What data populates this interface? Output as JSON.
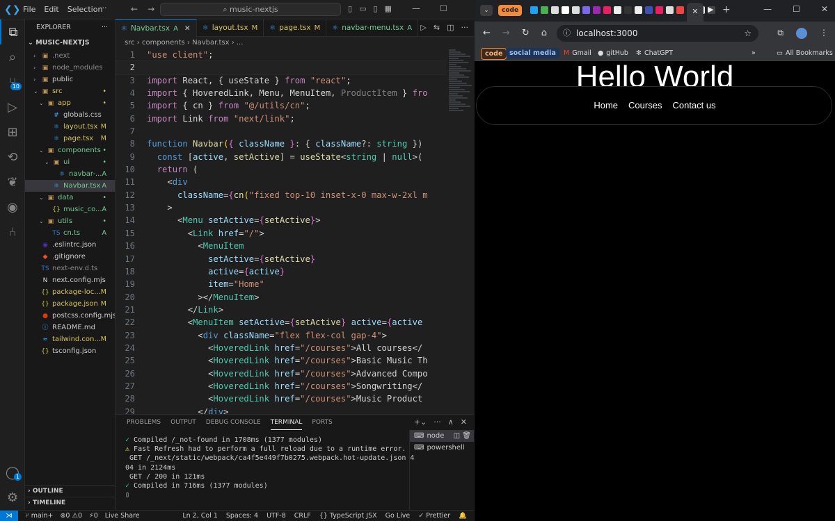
{
  "vscode": {
    "menu": [
      "File",
      "Edit",
      "Selection"
    ],
    "search": "music-nextjs",
    "explorer_title": "EXPLORER",
    "root": "MUSIC-NEXTJS",
    "tree": [
      {
        "name": ".next",
        "indent": 1,
        "type": "folder",
        "status": "",
        "color": "#8b8b8b"
      },
      {
        "name": "node_modules",
        "indent": 1,
        "type": "folder",
        "status": "",
        "color": "#8b8b8b"
      },
      {
        "name": "public",
        "indent": 1,
        "type": "folder",
        "status": "",
        "color": "#cccccc"
      },
      {
        "name": "src",
        "indent": 1,
        "type": "folder-open",
        "status": "•",
        "color": "#d7c45b"
      },
      {
        "name": "app",
        "indent": 2,
        "type": "folder-open",
        "status": "•",
        "color": "#d7c45b"
      },
      {
        "name": "globals.css",
        "indent": 3,
        "type": "css",
        "status": "",
        "color": "#cccccc"
      },
      {
        "name": "layout.tsx",
        "indent": 3,
        "type": "tsx",
        "status": "M",
        "color": "#d7c45b"
      },
      {
        "name": "page.tsx",
        "indent": 3,
        "type": "tsx",
        "status": "M",
        "color": "#d7c45b"
      },
      {
        "name": "components",
        "indent": 2,
        "type": "folder-open",
        "status": "•",
        "color": "#73c991"
      },
      {
        "name": "ui",
        "indent": 3,
        "type": "folder-open",
        "status": "•",
        "color": "#73c991"
      },
      {
        "name": "navbar-...",
        "indent": 4,
        "type": "tsx",
        "status": "A",
        "color": "#73c991"
      },
      {
        "name": "Navbar.tsx",
        "indent": 3,
        "type": "tsx",
        "status": "A",
        "color": "#73c991",
        "selected": true
      },
      {
        "name": "data",
        "indent": 2,
        "type": "folder-open",
        "status": "•",
        "color": "#73c991"
      },
      {
        "name": "music_co...",
        "indent": 3,
        "type": "json",
        "status": "A",
        "color": "#73c991"
      },
      {
        "name": "utils",
        "indent": 2,
        "type": "folder-open",
        "status": "•",
        "color": "#73c991"
      },
      {
        "name": "cn.ts",
        "indent": 3,
        "type": "ts",
        "status": "A",
        "color": "#73c991"
      },
      {
        "name": ".eslintrc.json",
        "indent": 1,
        "type": "eslint",
        "status": "",
        "color": "#cccccc"
      },
      {
        "name": ".gitignore",
        "indent": 1,
        "type": "git",
        "status": "",
        "color": "#cccccc"
      },
      {
        "name": "next-env.d.ts",
        "indent": 1,
        "type": "ts",
        "status": "",
        "color": "#8b8b8b"
      },
      {
        "name": "next.config.mjs",
        "indent": 1,
        "type": "next",
        "status": "",
        "color": "#cccccc"
      },
      {
        "name": "package-loc...",
        "indent": 1,
        "type": "json",
        "status": "M",
        "color": "#d7c45b"
      },
      {
        "name": "package.json",
        "indent": 1,
        "type": "json",
        "status": "M",
        "color": "#d7c45b"
      },
      {
        "name": "postcss.config.mjs",
        "indent": 1,
        "type": "postcss",
        "status": "",
        "color": "#cccccc"
      },
      {
        "name": "README.md",
        "indent": 1,
        "type": "info",
        "status": "",
        "color": "#cccccc"
      },
      {
        "name": "tailwind.con...",
        "indent": 1,
        "type": "tw",
        "status": "M",
        "color": "#d7c45b"
      },
      {
        "name": "tsconfig.json",
        "indent": 1,
        "type": "json",
        "status": "",
        "color": "#cccccc"
      }
    ],
    "outline": "OUTLINE",
    "timeline": "TIMELINE",
    "tabs": [
      {
        "name": "Navbar.tsx",
        "mark": "A",
        "active": true,
        "color": "#73c991"
      },
      {
        "name": "layout.tsx",
        "mark": "M",
        "active": false,
        "color": "#d7c45b"
      },
      {
        "name": "page.tsx",
        "mark": "M",
        "active": false,
        "color": "#d7c45b"
      },
      {
        "name": "navbar-menu.tsx",
        "mark": "A",
        "active": false,
        "color": "#73c991"
      }
    ],
    "breadcrumb": "src › components › Navbar.tsx › ...",
    "scm_badge": "10",
    "account_badge": "1",
    "panel_tabs": [
      "PROBLEMS",
      "OUTPUT",
      "DEBUG CONSOLE",
      "TERMINAL",
      "PORTS"
    ],
    "terminal_lines": [
      "✓ Compiled /_not-found in 1708ms (1377 modules)",
      "⚠ Fast Refresh had to perform a full reload due to a runtime error.",
      " GET /_next/static/webpack/ca4f5e449f7b0275.webpack.hot-update.json 4",
      "04 in 2124ms",
      " GET / 200 in 121ms",
      "✓ Compiled in 716ms (1377 modules)",
      "▯"
    ],
    "terminals": [
      "node",
      "powershell"
    ],
    "status_left": [
      "main+",
      "⊗0 ⚠0",
      "⚡0",
      "Live Share"
    ],
    "status_right": [
      "Ln 2, Col 1",
      "Spaces: 4",
      "UTF-8",
      "CRLF",
      "{} TypeScript JSX",
      "Go Live",
      "✓ Prettier"
    ]
  },
  "code_lines": [
    [
      [
        "s",
        "\"use client\""
      ],
      [
        "p",
        ";"
      ]
    ],
    [],
    [
      [
        "k",
        "import"
      ],
      [
        "p",
        " React, { useState } "
      ],
      [
        "k",
        "from"
      ],
      [
        "p",
        " "
      ],
      [
        "s",
        "\"react\""
      ],
      [
        "p",
        ";"
      ]
    ],
    [
      [
        "k",
        "import"
      ],
      [
        "p",
        " { HoveredLink, Menu, MenuItem, "
      ],
      [
        "g",
        "ProductItem"
      ],
      [
        "p",
        " } "
      ],
      [
        "k",
        "fro"
      ]
    ],
    [
      [
        "k",
        "import"
      ],
      [
        "p",
        " { cn } "
      ],
      [
        "k",
        "from"
      ],
      [
        "p",
        " "
      ],
      [
        "s",
        "\"@/utils/cn\""
      ],
      [
        "p",
        ";"
      ]
    ],
    [
      [
        "k",
        "import"
      ],
      [
        "p",
        " Link "
      ],
      [
        "k",
        "from"
      ],
      [
        "p",
        " "
      ],
      [
        "s",
        "\"next/link\""
      ],
      [
        "p",
        ";"
      ]
    ],
    [],
    [
      [
        "kb",
        "function"
      ],
      [
        "p",
        " "
      ],
      [
        "f",
        "Navbar"
      ],
      [
        "y",
        "("
      ],
      [
        "pk",
        "{"
      ],
      [
        "p",
        " "
      ],
      [
        "v",
        "className"
      ],
      [
        "p",
        " "
      ],
      [
        "pk",
        "}"
      ],
      [
        "p",
        ": { "
      ],
      [
        "v",
        "className"
      ],
      [
        "p",
        "?: "
      ],
      [
        "t",
        "string"
      ],
      [
        "p",
        " })"
      ]
    ],
    [
      [
        "p",
        "  "
      ],
      [
        "kb",
        "const"
      ],
      [
        "p",
        " ["
      ],
      [
        "v",
        "active"
      ],
      [
        "p",
        ", "
      ],
      [
        "f",
        "setActive"
      ],
      [
        "p",
        "] = "
      ],
      [
        "f",
        "useState"
      ],
      [
        "p",
        "<"
      ],
      [
        "t",
        "string"
      ],
      [
        "p",
        " | "
      ],
      [
        "t",
        "null"
      ],
      [
        "p",
        ">("
      ]
    ],
    [
      [
        "p",
        "  "
      ],
      [
        "k",
        "return"
      ],
      [
        "p",
        " ("
      ]
    ],
    [
      [
        "p",
        "    <"
      ],
      [
        "kb",
        "div"
      ]
    ],
    [
      [
        "p",
        "      "
      ],
      [
        "v",
        "className"
      ],
      [
        "p",
        "="
      ],
      [
        "pk",
        "{"
      ],
      [
        "f",
        "cn"
      ],
      [
        "y",
        "("
      ],
      [
        "s",
        "\"fixed top-10 inset-x-0 max-w-2xl m"
      ]
    ],
    [
      [
        "p",
        "    >"
      ]
    ],
    [
      [
        "p",
        "      <"
      ],
      [
        "t",
        "Menu"
      ],
      [
        "p",
        " "
      ],
      [
        "v",
        "setActive"
      ],
      [
        "p",
        "="
      ],
      [
        "pk",
        "{"
      ],
      [
        "f",
        "setActive"
      ],
      [
        "pk",
        "}"
      ],
      [
        "p",
        ">"
      ]
    ],
    [
      [
        "p",
        "        <"
      ],
      [
        "t",
        "Link"
      ],
      [
        "p",
        " "
      ],
      [
        "v",
        "href"
      ],
      [
        "p",
        "="
      ],
      [
        "s",
        "\"/\""
      ],
      [
        "p",
        ">"
      ]
    ],
    [
      [
        "p",
        "          <"
      ],
      [
        "t",
        "MenuItem"
      ]
    ],
    [
      [
        "p",
        "            "
      ],
      [
        "v",
        "setActive"
      ],
      [
        "p",
        "="
      ],
      [
        "pk",
        "{"
      ],
      [
        "f",
        "setActive"
      ],
      [
        "pk",
        "}"
      ]
    ],
    [
      [
        "p",
        "            "
      ],
      [
        "v",
        "active"
      ],
      [
        "p",
        "="
      ],
      [
        "pk",
        "{"
      ],
      [
        "v",
        "active"
      ],
      [
        "pk",
        "}"
      ]
    ],
    [
      [
        "p",
        "            "
      ],
      [
        "v",
        "item"
      ],
      [
        "p",
        "="
      ],
      [
        "s",
        "\"Home\""
      ]
    ],
    [
      [
        "p",
        "          ></"
      ],
      [
        "t",
        "MenuItem"
      ],
      [
        "p",
        ">"
      ]
    ],
    [
      [
        "p",
        "        </"
      ],
      [
        "t",
        "Link"
      ],
      [
        "p",
        ">"
      ]
    ],
    [
      [
        "p",
        "        <"
      ],
      [
        "t",
        "MenuItem"
      ],
      [
        "p",
        " "
      ],
      [
        "v",
        "setActive"
      ],
      [
        "p",
        "="
      ],
      [
        "pk",
        "{"
      ],
      [
        "f",
        "setActive"
      ],
      [
        "pk",
        "}"
      ],
      [
        "p",
        " "
      ],
      [
        "v",
        "active"
      ],
      [
        "p",
        "="
      ],
      [
        "pk",
        "{"
      ],
      [
        "v",
        "active"
      ]
    ],
    [
      [
        "p",
        "          <"
      ],
      [
        "kb",
        "div"
      ],
      [
        "p",
        " "
      ],
      [
        "v",
        "className"
      ],
      [
        "p",
        "="
      ],
      [
        "s",
        "\"flex flex-col gap-4\""
      ],
      [
        "p",
        ">"
      ]
    ],
    [
      [
        "p",
        "            <"
      ],
      [
        "t",
        "HoveredLink"
      ],
      [
        "p",
        " "
      ],
      [
        "v",
        "href"
      ],
      [
        "p",
        "="
      ],
      [
        "s",
        "\"/courses\""
      ],
      [
        "p",
        ">All courses</"
      ]
    ],
    [
      [
        "p",
        "            <"
      ],
      [
        "t",
        "HoveredLink"
      ],
      [
        "p",
        " "
      ],
      [
        "v",
        "href"
      ],
      [
        "p",
        "="
      ],
      [
        "s",
        "\"/courses\""
      ],
      [
        "p",
        ">Basic Music Th"
      ]
    ],
    [
      [
        "p",
        "            <"
      ],
      [
        "t",
        "HoveredLink"
      ],
      [
        "p",
        " "
      ],
      [
        "v",
        "href"
      ],
      [
        "p",
        "="
      ],
      [
        "s",
        "\"/courses\""
      ],
      [
        "p",
        ">Advanced Compo"
      ]
    ],
    [
      [
        "p",
        "            <"
      ],
      [
        "t",
        "HoveredLink"
      ],
      [
        "p",
        " "
      ],
      [
        "v",
        "href"
      ],
      [
        "p",
        "="
      ],
      [
        "s",
        "\"/courses\""
      ],
      [
        "p",
        ">Songwriting</"
      ]
    ],
    [
      [
        "p",
        "            <"
      ],
      [
        "t",
        "HoveredLink"
      ],
      [
        "p",
        " "
      ],
      [
        "v",
        "href"
      ],
      [
        "p",
        "="
      ],
      [
        "s",
        "\"/courses\""
      ],
      [
        "p",
        ">Music Product"
      ]
    ],
    [
      [
        "p",
        "          </"
      ],
      [
        "kb",
        "div"
      ],
      [
        "p",
        ">"
      ]
    ]
  ],
  "browser": {
    "group_label": "code",
    "url": "localhost:3000",
    "bookmarks": [
      "code",
      "social media",
      "Gmail",
      "gitHub",
      "ChatGPT",
      "All Bookmarks"
    ],
    "hello": "Hello World",
    "nav": [
      "Home",
      "Courses",
      "Contact us"
    ],
    "fav_colors": [
      "#1da1f2",
      "#4caf50",
      "#ddd",
      "#fff",
      "#ddd",
      "#7b68ee",
      "#9c27b0",
      "#e91e63",
      "#eee",
      "#333",
      "#eee",
      "#3f51b5",
      "#e91e63",
      "#ddd",
      "#e44",
      "#222",
      "#eee",
      "#444"
    ]
  }
}
